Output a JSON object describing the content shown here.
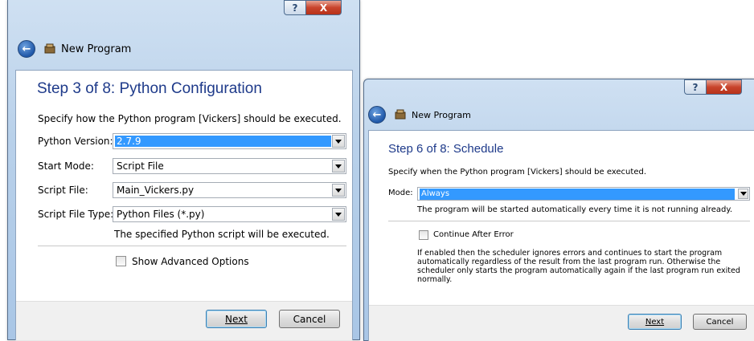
{
  "left": {
    "nav_title": "New Program",
    "step_title": "Step 3 of 8: Python Configuration",
    "description": "Specify how the Python program [Vickers] should be executed.",
    "fields": [
      {
        "label": "Python Version:",
        "value": "2.7.9"
      },
      {
        "label": "Start Mode:",
        "value": "Script File"
      },
      {
        "label": "Script File:",
        "value": "Main_Vickers.py"
      },
      {
        "label": "Script File Type:",
        "value": "Python Files (*.py)"
      }
    ],
    "hint": "The specified Python script will be executed.",
    "advanced_checkbox_label": "Show Advanced Options",
    "next_label": "Next",
    "cancel_label": "Cancel",
    "help_glyph": "?",
    "close_glyph": "X"
  },
  "right": {
    "nav_title": "New Program",
    "step_title": "Step 6 of 8: Schedule",
    "description": "Specify when the Python program [Vickers] should be executed.",
    "mode_label": "Mode:",
    "mode_value": "Always",
    "mode_hint": "The program will be started automatically every time it is not running already.",
    "continue_label": "Continue After Error",
    "continue_desc_lines": [
      "If enabled then the scheduler ignores errors and continues to start the program",
      "automatically regardless of the result from the last program run. Otherwise the",
      "scheduler only starts the program automatically again if the last program run exited",
      "normally."
    ],
    "next_label": "Next",
    "cancel_label": "Cancel",
    "help_glyph": "?",
    "close_glyph": "X"
  },
  "colors": {
    "heading": "#1e3a8a",
    "selection": "#3399ff",
    "close_button": "#c8442c",
    "frame": "#b9d1ea"
  },
  "icons": [
    "back-arrow-icon",
    "app-icon",
    "dropdown-arrow-icon",
    "help-icon",
    "close-icon"
  ]
}
